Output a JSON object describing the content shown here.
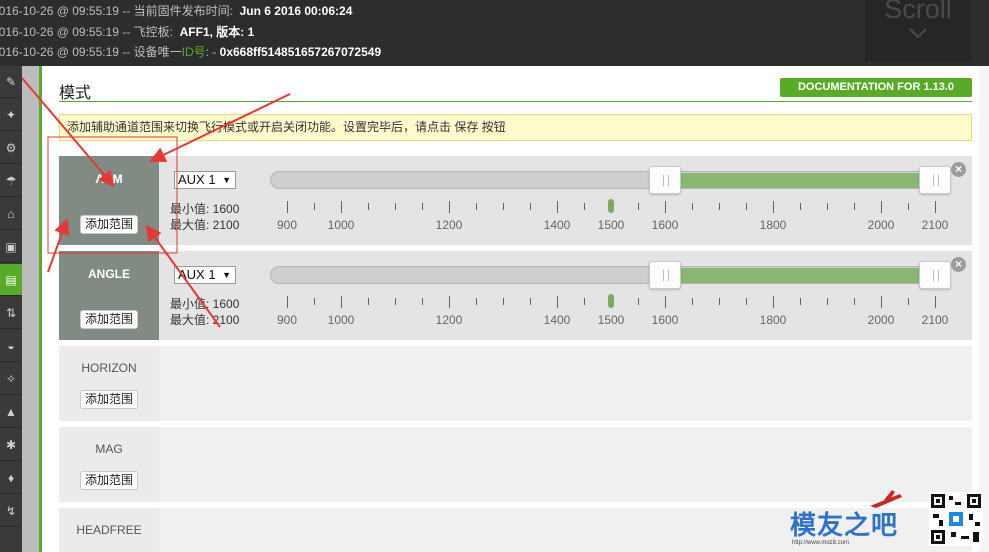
{
  "log": {
    "lines": [
      {
        "prefix": "2016-10-26 @ 09:55:19 -- 当前固件发布时间:",
        "value": "Jun 6 2016 00:06:24"
      },
      {
        "prefix": "2016-10-26 @ 09:55:19 -- 飞控板:",
        "value": "AFF1, 版本: 1"
      },
      {
        "prefix": "2016-10-26 @ 09:55:19 -- 设备唯一",
        "highlight": "ID号",
        "suffix": ": -",
        "value": "0x668ff514851657267072549"
      }
    ],
    "scroll_label": "Scroll"
  },
  "sidebar": {
    "items": [
      {
        "icon": "wrench-icon"
      },
      {
        "icon": "wizard-icon"
      },
      {
        "icon": "gear-icon"
      },
      {
        "icon": "parachute-icon"
      },
      {
        "icon": "receiver-icon"
      },
      {
        "icon": "lock-icon"
      },
      {
        "icon": "modes-icon",
        "active": true
      },
      {
        "icon": "adjustments-icon"
      },
      {
        "icon": "servos-icon"
      },
      {
        "icon": "gps-icon"
      },
      {
        "icon": "motors-icon"
      },
      {
        "icon": "led-icon"
      },
      {
        "icon": "sensors-icon"
      },
      {
        "icon": "logging-icon"
      }
    ]
  },
  "page": {
    "title": "模式",
    "doc_button": "DOCUMENTATION FOR 1.13.0",
    "notice": "添加辅助通道范围来切换飞行模式或开启关闭功能。设置完毕后，请点击 保存 按钮"
  },
  "modes": [
    {
      "name": "ARM",
      "add_label": "添加范围",
      "active": true,
      "aux": "AUX 1",
      "min_label": "最小值: 1600",
      "max_label": "最大值: 2100",
      "range_min": 1600,
      "range_max": 2100,
      "current": 1500
    },
    {
      "name": "ANGLE",
      "add_label": "添加范围",
      "active": true,
      "aux": "AUX 1",
      "min_label": "最小值: 1600",
      "max_label": "最大值: 2100",
      "range_min": 1600,
      "range_max": 2100,
      "current": 1500
    },
    {
      "name": "HORIZON",
      "add_label": "添加范围",
      "active": false
    },
    {
      "name": "MAG",
      "add_label": "添加范围",
      "active": false
    },
    {
      "name": "HEADFREE",
      "add_label": "",
      "active": false
    }
  ],
  "scale": {
    "min": 900,
    "max": 2100,
    "labels": [
      "900",
      "1000",
      "1200",
      "1400",
      "1500",
      "1600",
      "1800",
      "2000",
      "2100"
    ],
    "label_values": [
      900,
      1000,
      1200,
      1400,
      1500,
      1600,
      1800,
      2000,
      2100
    ]
  },
  "watermark": {
    "text": "模友之吧",
    "url": "http://www.moz8.com"
  },
  "colors": {
    "accent": "#59aa29",
    "range_fill": "#8ab872",
    "active_mode": "#828a84",
    "annotation": "#e53935"
  }
}
